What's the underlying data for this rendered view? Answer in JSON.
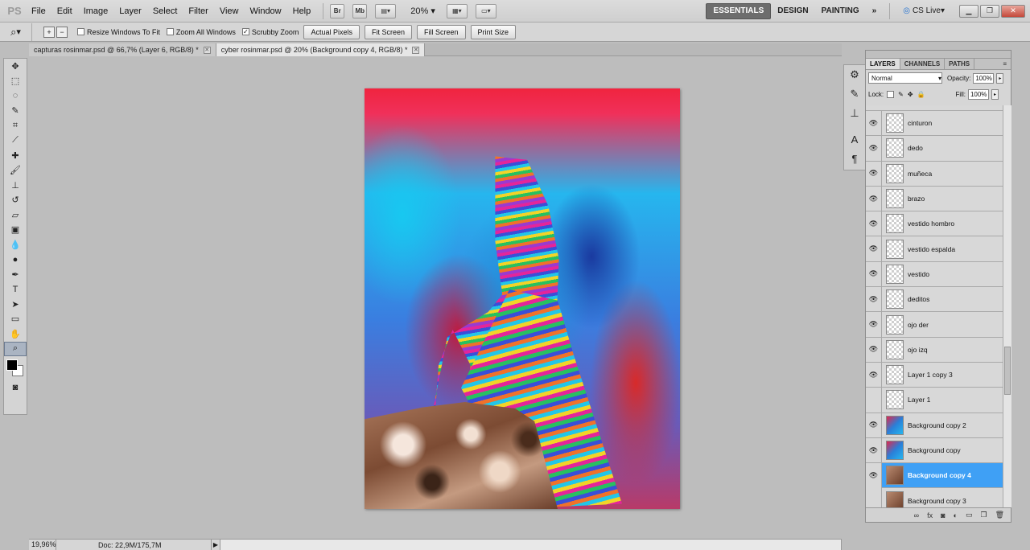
{
  "app": {
    "logo": "PS"
  },
  "menu": [
    "File",
    "Edit",
    "Image",
    "Layer",
    "Select",
    "Filter",
    "View",
    "Window",
    "Help"
  ],
  "appbar": {
    "bridge": "Br",
    "minibridge": "Mb",
    "zoom": "20%"
  },
  "workspaces": {
    "essentials": "ESSENTIALS",
    "design": "DESIGN",
    "painting": "PAINTING",
    "more": "»",
    "cslive": "CS Live"
  },
  "options": {
    "resize_windows": "Resize Windows To Fit",
    "zoom_all": "Zoom All Windows",
    "scrubby": "Scrubby Zoom",
    "actual_pixels": "Actual Pixels",
    "fit_screen": "Fit Screen",
    "fill_screen": "Fill Screen",
    "print_size": "Print Size"
  },
  "tabs": [
    {
      "label": "capturas rosinmar.psd @ 66,7% (Layer 6, RGB/8) *"
    },
    {
      "label": "cyber rosinmar.psd @ 20% (Background copy 4, RGB/8) *"
    }
  ],
  "status": {
    "zoom": "19,96%",
    "doc": "Doc: 22,9M/175,7M"
  },
  "layers_panel": {
    "tabs": [
      "LAYERS",
      "CHANNELS",
      "PATHS"
    ],
    "blend_mode": "Normal",
    "opacity_label": "Opacity:",
    "opacity": "100%",
    "lock_label": "Lock:",
    "fill_label": "Fill:",
    "fill": "100%",
    "layers": [
      {
        "name": "cinturon"
      },
      {
        "name": "dedo"
      },
      {
        "name": "muñeca"
      },
      {
        "name": "brazo"
      },
      {
        "name": "vestido hombro"
      },
      {
        "name": "vestido espalda"
      },
      {
        "name": "vestido"
      },
      {
        "name": "deditos"
      },
      {
        "name": "ojo der"
      },
      {
        "name": "ojo izq"
      },
      {
        "name": "Layer 1 copy 3"
      },
      {
        "name": "Layer 1"
      },
      {
        "name": "Background copy 2"
      },
      {
        "name": "Background copy"
      },
      {
        "name": "Background copy 4"
      },
      {
        "name": "Background copy 3"
      }
    ]
  }
}
